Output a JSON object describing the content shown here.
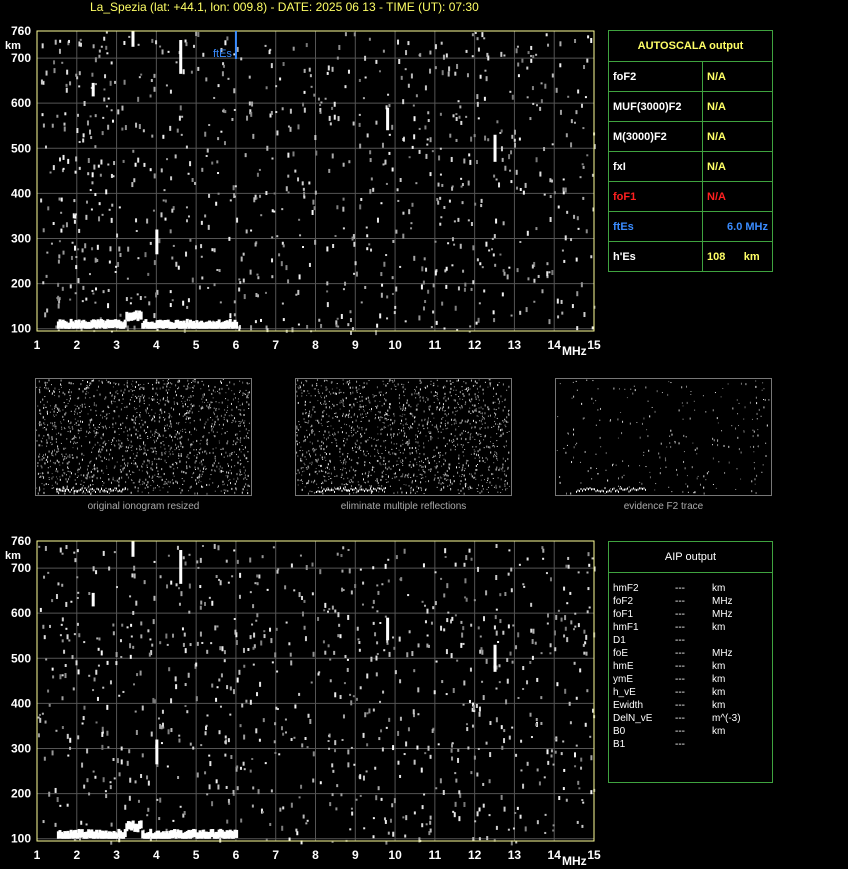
{
  "title": "La_Spezia (lat: +44.1, lon: 009.8) - DATE: 2025 06 13 - TIME (UT): 07:30",
  "autoscala": {
    "header": "AUTOSCALA output",
    "rows": [
      {
        "label": "foF2",
        "value": "N/A",
        "color": "#ffff66"
      },
      {
        "label": "MUF(3000)F2",
        "value": "N/A",
        "color": "#ffff66"
      },
      {
        "label": "M(3000)F2",
        "value": "N/A",
        "color": "#ffff66"
      },
      {
        "label": "fxI",
        "value": "N/A",
        "color": "#ffff66"
      },
      {
        "label": "foF1",
        "value": "N/A",
        "color": "#ff2020"
      },
      {
        "label": "ftEs",
        "value": "6.0 MHz",
        "color": "#3a8cff"
      },
      {
        "label": "h'Es",
        "value": "108",
        "unit": "km",
        "color": "#ffff66"
      }
    ]
  },
  "aip": {
    "header": "AIP output",
    "rows": [
      {
        "label": "hmF2",
        "val": "---",
        "unit": "km"
      },
      {
        "label": "foF2",
        "val": "---",
        "unit": "MHz"
      },
      {
        "label": "foF1",
        "val": "---",
        "unit": "MHz"
      },
      {
        "label": "hmF1",
        "val": "---",
        "unit": "km"
      },
      {
        "label": "D1",
        "val": "---",
        "unit": ""
      },
      {
        "label": "foE",
        "val": "---",
        "unit": "MHz"
      },
      {
        "label": "hmE",
        "val": "---",
        "unit": "km"
      },
      {
        "label": "ymE",
        "val": "---",
        "unit": "km"
      },
      {
        "label": "h_vE",
        "val": "---",
        "unit": "km"
      },
      {
        "label": "Ewidth",
        "val": "---",
        "unit": "km"
      },
      {
        "label": "DelN_vE",
        "val": "---",
        "unit": "m^(-3)"
      },
      {
        "label": "B0",
        "val": "---",
        "unit": "km"
      },
      {
        "label": "B1",
        "val": "---",
        "unit": ""
      }
    ]
  },
  "thumbnails": [
    {
      "caption": "original ionogram resized"
    },
    {
      "caption": "eliminate multiple reflections"
    },
    {
      "caption": "evidence F2 trace"
    }
  ],
  "chart_data": [
    {
      "type": "scatter",
      "name_tag": "top",
      "xlabel": "MHz",
      "ylabel": "km",
      "xlim": [
        1,
        15
      ],
      "ylim": [
        95,
        760
      ],
      "xticks": [
        1,
        2,
        3,
        4,
        5,
        6,
        7,
        8,
        9,
        10,
        11,
        12,
        13,
        14,
        15
      ],
      "yticks": [
        100,
        200,
        300,
        400,
        500,
        600,
        700,
        760
      ],
      "grid": true,
      "annotation": {
        "text": "ftEs",
        "x": 6.0,
        "color": "#3a8cff"
      },
      "es_trace": {
        "x_start": 1.5,
        "x_end": 6.0,
        "height": 115
      },
      "traces": [
        {
          "x": 2.4,
          "y": [
            615,
            645
          ]
        },
        {
          "x": 3.4,
          "y": [
            725,
            760
          ]
        },
        {
          "x": 4.6,
          "y": [
            665,
            740
          ]
        },
        {
          "x": 4.0,
          "y": [
            265,
            320
          ]
        },
        {
          "x": 9.8,
          "y": [
            540,
            590
          ]
        },
        {
          "x": 12.5,
          "y": [
            470,
            530
          ]
        }
      ]
    },
    {
      "type": "scatter",
      "name_tag": "bottom",
      "xlabel": "MHz",
      "ylabel": "km",
      "xlim": [
        1,
        15
      ],
      "ylim": [
        95,
        760
      ],
      "xticks": [
        1,
        2,
        3,
        4,
        5,
        6,
        7,
        8,
        9,
        10,
        11,
        12,
        13,
        14,
        15
      ],
      "yticks": [
        100,
        200,
        300,
        400,
        500,
        600,
        700,
        760
      ],
      "grid": true,
      "es_trace": {
        "x_start": 1.5,
        "x_end": 6.0,
        "height": 115
      },
      "traces": [
        {
          "x": 2.4,
          "y": [
            615,
            645
          ]
        },
        {
          "x": 3.4,
          "y": [
            725,
            760
          ]
        },
        {
          "x": 4.6,
          "y": [
            665,
            740
          ]
        },
        {
          "x": 4.0,
          "y": [
            265,
            320
          ]
        },
        {
          "x": 9.8,
          "y": [
            540,
            590
          ]
        },
        {
          "x": 12.5,
          "y": [
            470,
            530
          ]
        }
      ]
    }
  ]
}
